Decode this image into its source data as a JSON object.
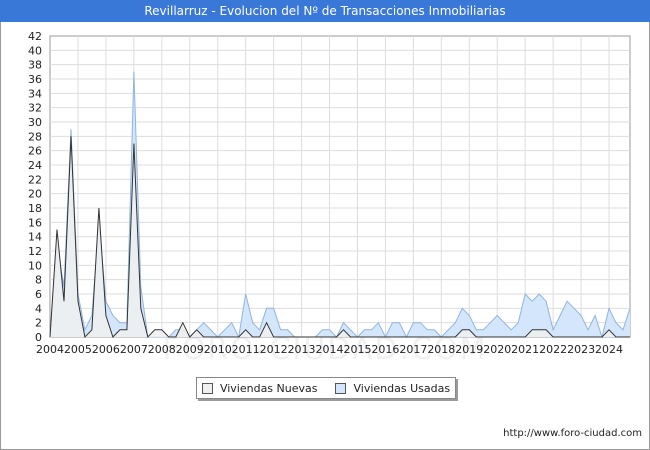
{
  "chart_data": {
    "type": "area",
    "title": "Revillarruz - Evolucion del Nº de Transacciones Inmobiliarias",
    "xlabel": "",
    "ylabel": "",
    "ylim": [
      0,
      42
    ],
    "yticks": [
      0,
      2,
      4,
      6,
      8,
      10,
      12,
      14,
      16,
      18,
      20,
      22,
      24,
      26,
      28,
      30,
      32,
      34,
      36,
      38,
      40,
      42
    ],
    "xlim": [
      2004,
      2024.75
    ],
    "year_ticks": [
      2004,
      2005,
      2006,
      2007,
      2008,
      2009,
      2010,
      2011,
      2012,
      2013,
      2014,
      2015,
      2016,
      2017,
      2018,
      2019,
      2020,
      2021,
      2022,
      2023,
      2024
    ],
    "grid": true,
    "legend_position": "bottom-center",
    "series": [
      {
        "name": "Viviendas Nuevas",
        "color": "#f0f0f0",
        "line_color": "#333333",
        "points": [
          [
            2004.0,
            0
          ],
          [
            2004.25,
            15
          ],
          [
            2004.5,
            5
          ],
          [
            2004.75,
            28
          ],
          [
            2005.0,
            5
          ],
          [
            2005.25,
            0
          ],
          [
            2005.5,
            1
          ],
          [
            2005.75,
            18
          ],
          [
            2006.0,
            3
          ],
          [
            2006.25,
            0
          ],
          [
            2006.5,
            1
          ],
          [
            2006.75,
            1
          ],
          [
            2007.0,
            27
          ],
          [
            2007.25,
            4
          ],
          [
            2007.5,
            0
          ],
          [
            2007.75,
            1
          ],
          [
            2008.0,
            1
          ],
          [
            2008.25,
            0
          ],
          [
            2008.5,
            0
          ],
          [
            2008.75,
            2
          ],
          [
            2009.0,
            0
          ],
          [
            2009.25,
            1
          ],
          [
            2009.5,
            0
          ],
          [
            2009.75,
            0
          ],
          [
            2010.0,
            0
          ],
          [
            2010.25,
            0
          ],
          [
            2010.5,
            0
          ],
          [
            2010.75,
            0
          ],
          [
            2011.0,
            1
          ],
          [
            2011.25,
            0
          ],
          [
            2011.5,
            0
          ],
          [
            2011.75,
            2
          ],
          [
            2012.0,
            0
          ],
          [
            2012.25,
            0
          ],
          [
            2012.5,
            0
          ],
          [
            2012.75,
            0
          ],
          [
            2013.0,
            0
          ],
          [
            2013.25,
            0
          ],
          [
            2013.5,
            0
          ],
          [
            2013.75,
            0
          ],
          [
            2014.0,
            0
          ],
          [
            2014.25,
            0
          ],
          [
            2014.5,
            1
          ],
          [
            2014.75,
            0
          ],
          [
            2015.0,
            0
          ],
          [
            2015.25,
            0
          ],
          [
            2015.5,
            0
          ],
          [
            2015.75,
            0
          ],
          [
            2016.0,
            0
          ],
          [
            2016.25,
            0
          ],
          [
            2016.5,
            0
          ],
          [
            2016.75,
            0
          ],
          [
            2017.0,
            0
          ],
          [
            2017.25,
            0
          ],
          [
            2017.5,
            0
          ],
          [
            2017.75,
            0
          ],
          [
            2018.0,
            0
          ],
          [
            2018.25,
            0
          ],
          [
            2018.5,
            0
          ],
          [
            2018.75,
            1
          ],
          [
            2019.0,
            1
          ],
          [
            2019.25,
            0
          ],
          [
            2019.5,
            0
          ],
          [
            2019.75,
            0
          ],
          [
            2020.0,
            0
          ],
          [
            2020.25,
            0
          ],
          [
            2020.5,
            0
          ],
          [
            2020.75,
            0
          ],
          [
            2021.0,
            0
          ],
          [
            2021.25,
            1
          ],
          [
            2021.5,
            1
          ],
          [
            2021.75,
            1
          ],
          [
            2022.0,
            0
          ],
          [
            2022.25,
            0
          ],
          [
            2022.5,
            0
          ],
          [
            2022.75,
            0
          ],
          [
            2023.0,
            0
          ],
          [
            2023.25,
            0
          ],
          [
            2023.5,
            0
          ],
          [
            2023.75,
            0
          ],
          [
            2024.0,
            1
          ],
          [
            2024.25,
            0
          ],
          [
            2024.5,
            0
          ],
          [
            2024.75,
            0
          ]
        ]
      },
      {
        "name": "Viviendas Usadas",
        "color": "#d4e6fb",
        "line_color": "#8fb4e0",
        "points": [
          [
            2004.0,
            0
          ],
          [
            2004.25,
            13
          ],
          [
            2004.5,
            7
          ],
          [
            2004.75,
            29
          ],
          [
            2005.0,
            6
          ],
          [
            2005.25,
            1
          ],
          [
            2005.5,
            3
          ],
          [
            2005.75,
            16
          ],
          [
            2006.0,
            5
          ],
          [
            2006.25,
            3
          ],
          [
            2006.5,
            2
          ],
          [
            2006.75,
            2
          ],
          [
            2007.0,
            37
          ],
          [
            2007.25,
            7
          ],
          [
            2007.5,
            0
          ],
          [
            2007.75,
            0
          ],
          [
            2008.0,
            0
          ],
          [
            2008.25,
            0
          ],
          [
            2008.5,
            1
          ],
          [
            2008.75,
            1
          ],
          [
            2009.0,
            0
          ],
          [
            2009.25,
            1
          ],
          [
            2009.5,
            2
          ],
          [
            2009.75,
            1
          ],
          [
            2010.0,
            0
          ],
          [
            2010.25,
            1
          ],
          [
            2010.5,
            2
          ],
          [
            2010.75,
            0
          ],
          [
            2011.0,
            6
          ],
          [
            2011.25,
            2
          ],
          [
            2011.5,
            1
          ],
          [
            2011.75,
            4
          ],
          [
            2012.0,
            4
          ],
          [
            2012.25,
            1
          ],
          [
            2012.5,
            1
          ],
          [
            2012.75,
            0
          ],
          [
            2013.0,
            0
          ],
          [
            2013.25,
            0
          ],
          [
            2013.5,
            0
          ],
          [
            2013.75,
            1
          ],
          [
            2014.0,
            1
          ],
          [
            2014.25,
            0
          ],
          [
            2014.5,
            2
          ],
          [
            2014.75,
            1
          ],
          [
            2015.0,
            0
          ],
          [
            2015.25,
            1
          ],
          [
            2015.5,
            1
          ],
          [
            2015.75,
            2
          ],
          [
            2016.0,
            0
          ],
          [
            2016.25,
            2
          ],
          [
            2016.5,
            2
          ],
          [
            2016.75,
            0
          ],
          [
            2017.0,
            2
          ],
          [
            2017.25,
            2
          ],
          [
            2017.5,
            1
          ],
          [
            2017.75,
            1
          ],
          [
            2018.0,
            0
          ],
          [
            2018.25,
            1
          ],
          [
            2018.5,
            2
          ],
          [
            2018.75,
            4
          ],
          [
            2019.0,
            3
          ],
          [
            2019.25,
            1
          ],
          [
            2019.5,
            1
          ],
          [
            2019.75,
            2
          ],
          [
            2020.0,
            3
          ],
          [
            2020.25,
            2
          ],
          [
            2020.5,
            1
          ],
          [
            2020.75,
            2
          ],
          [
            2021.0,
            6
          ],
          [
            2021.25,
            5
          ],
          [
            2021.5,
            6
          ],
          [
            2021.75,
            5
          ],
          [
            2022.0,
            1
          ],
          [
            2022.25,
            3
          ],
          [
            2022.5,
            5
          ],
          [
            2022.75,
            4
          ],
          [
            2023.0,
            3
          ],
          [
            2023.25,
            1
          ],
          [
            2023.5,
            3
          ],
          [
            2023.75,
            0
          ],
          [
            2024.0,
            4
          ],
          [
            2024.25,
            2
          ],
          [
            2024.5,
            1
          ],
          [
            2024.75,
            4
          ]
        ]
      }
    ]
  },
  "footer": {
    "url": "http://www.foro-ciudad.com"
  },
  "watermark": {
    "text": "FORO-CIUDAD.COM"
  }
}
